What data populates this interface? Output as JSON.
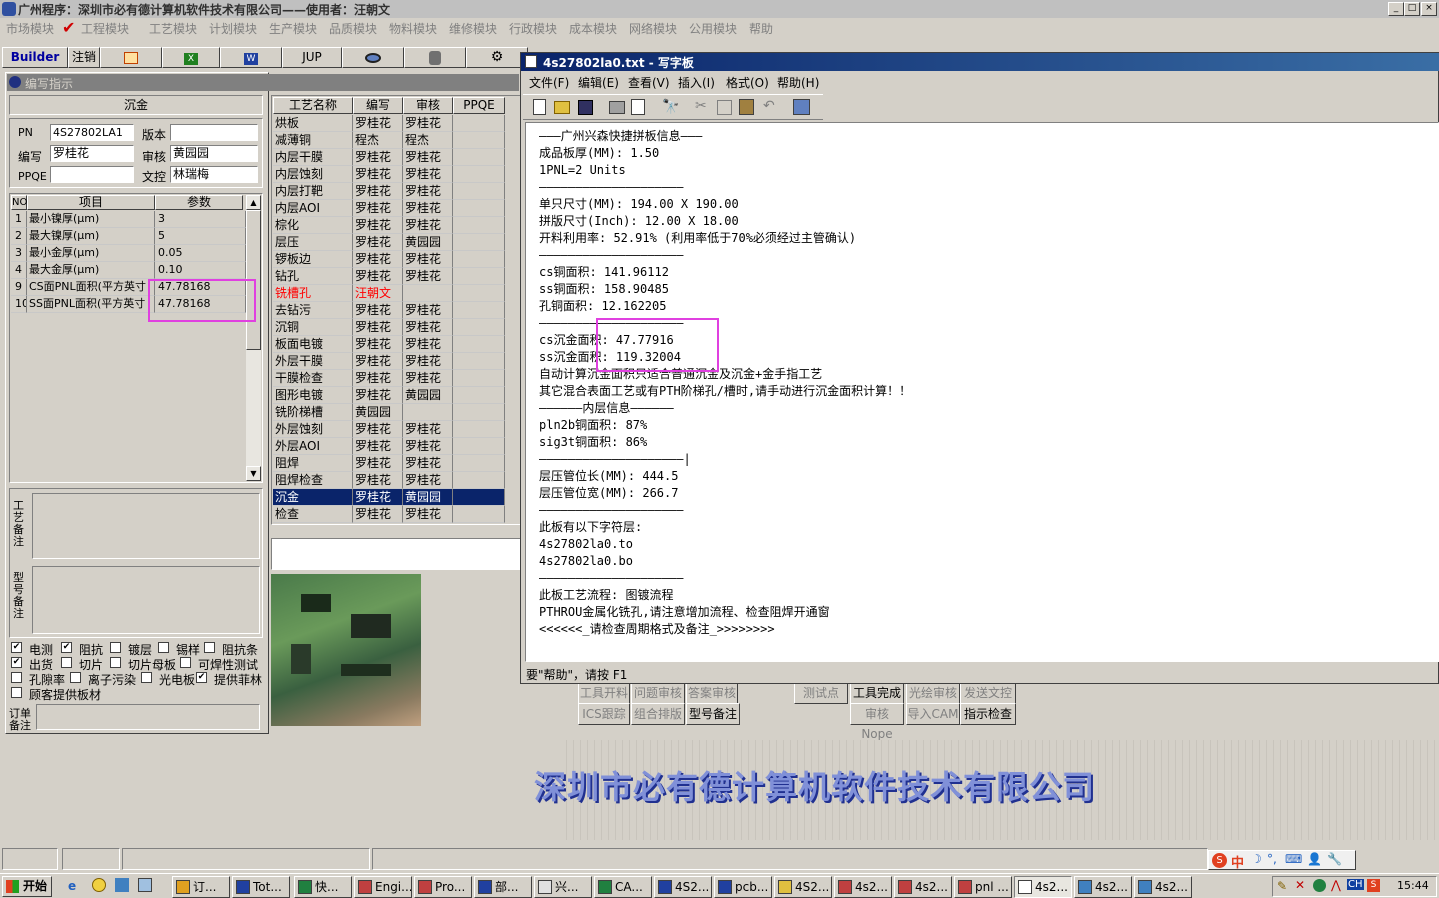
{
  "app": {
    "title": "广州程序：深圳市必有德计算机软件技术有限公司——使用者：汪朝文",
    "win_buttons": [
      "_",
      "□",
      "×"
    ],
    "menu": [
      "市场模块",
      "工程模块",
      "工艺模块",
      "计划模块",
      "生产模块",
      "品质模块",
      "物料模块",
      "维修模块",
      "行政模块",
      "成本模块",
      "网络模块",
      "公用模块",
      "帮助"
    ],
    "toolbar": [
      "Builder",
      "注销",
      "JUP"
    ],
    "brand": "深圳市必有德计算机软件技术有限公司"
  },
  "editor": {
    "title": "编写指示",
    "process": "沉金",
    "fields": {
      "pn_label": "PN",
      "pn": "4S27802LA1",
      "version_label": "版本",
      "version": "",
      "writer_label": "编写",
      "writer": "罗桂花",
      "reviewer_label": "审核",
      "reviewer": "黄园园",
      "ppqe_label": "PPQE",
      "ppqe": "",
      "doc_label": "文控",
      "doc": "林瑞梅"
    },
    "param_headers": [
      "NO",
      "项目",
      "参数"
    ],
    "params": [
      {
        "no": "1",
        "item": "最小镍厚(μm)",
        "value": "3"
      },
      {
        "no": "2",
        "item": "最大镍厚(μm)",
        "value": "5"
      },
      {
        "no": "3",
        "item": "最小金厚(μm)",
        "value": "0.05"
      },
      {
        "no": "4",
        "item": "最大金厚(μm)",
        "value": "0.10"
      },
      {
        "no": "9",
        "item": "CS面PNL面积(平方英寸",
        "value": "47.78168"
      },
      {
        "no": "10",
        "item": "SS面PNL面积(平方英寸",
        "value": "47.78168"
      }
    ],
    "remark1_label": "工艺备注",
    "remark2_label": "型号备注",
    "order_label": "订单备注",
    "checks": [
      {
        "label": "电测",
        "checked": true
      },
      {
        "label": "阻抗",
        "checked": true
      },
      {
        "label": "镀层",
        "checked": false
      },
      {
        "label": "锡样",
        "checked": false
      },
      {
        "label": "阻抗条",
        "checked": false
      },
      {
        "label": "出货",
        "checked": true
      },
      {
        "label": "切片",
        "checked": false
      },
      {
        "label": "切片母板",
        "checked": false
      },
      {
        "label": "可焊性测试",
        "checked": false
      },
      {
        "label": "孔隙率",
        "checked": false
      },
      {
        "label": "离子污染",
        "checked": false
      },
      {
        "label": "光电板",
        "checked": false
      },
      {
        "label": "提供菲林",
        "checked": true
      },
      {
        "label": "顾客提供板材",
        "checked": false
      }
    ]
  },
  "process_table": {
    "headers": [
      "工艺名称",
      "编写",
      "审核",
      "PPQE"
    ],
    "rows": [
      [
        "烘板",
        "罗桂花",
        "罗桂花"
      ],
      [
        "减薄铜",
        "程杰",
        "程杰"
      ],
      [
        "内层干膜",
        "罗桂花",
        "罗桂花"
      ],
      [
        "内层蚀刻",
        "罗桂花",
        "罗桂花"
      ],
      [
        "内层打靶",
        "罗桂花",
        "罗桂花"
      ],
      [
        "内层AOI",
        "罗桂花",
        "罗桂花"
      ],
      [
        "棕化",
        "罗桂花",
        "罗桂花"
      ],
      [
        "层压",
        "罗桂花",
        "黄园园"
      ],
      [
        "锣板边",
        "罗桂花",
        "罗桂花"
      ],
      [
        "钻孔",
        "罗桂花",
        "罗桂花"
      ],
      [
        "铣槽孔",
        "汪朝文",
        ""
      ],
      [
        "去钻污",
        "罗桂花",
        "罗桂花"
      ],
      [
        "沉铜",
        "罗桂花",
        "罗桂花"
      ],
      [
        "板面电镀",
        "罗桂花",
        "罗桂花"
      ],
      [
        "外层干膜",
        "罗桂花",
        "罗桂花"
      ],
      [
        "干膜检查",
        "罗桂花",
        "罗桂花"
      ],
      [
        "图形电镀",
        "罗桂花",
        "黄园园"
      ],
      [
        "铣阶梯槽",
        "黄园园",
        ""
      ],
      [
        "外层蚀刻",
        "罗桂花",
        "罗桂花"
      ],
      [
        "外层AOI",
        "罗桂花",
        "罗桂花"
      ],
      [
        "阻焊",
        "罗桂花",
        "罗桂花"
      ],
      [
        "阻焊检查",
        "罗桂花",
        "罗桂花"
      ],
      [
        "沉金",
        "罗桂花",
        "黄园园"
      ],
      [
        "检查",
        "罗桂花",
        "罗桂花"
      ]
    ],
    "highlight_row": 10,
    "selected_row": 22
  },
  "bottom_buttons": [
    "工具开料",
    "问题审核",
    "答案审核",
    "测试点",
    "工具完成",
    "光绘审核",
    "发送文控",
    "ICS跟踪",
    "组合排版",
    "型号备注",
    "审核Nope",
    "导入CAM",
    "指示检查"
  ],
  "wordpad": {
    "title": "4s27802la0.txt - 写字板",
    "menu": [
      "文件(F)",
      "编辑(E)",
      "查看(V)",
      "插入(I)",
      "格式(O)",
      "帮助(H)"
    ],
    "status": "要\"帮助\"，请按 F1",
    "lines": [
      "———广州兴森快捷拼板信息———",
      "成品板厚(MM): 1.50",
      "1PNL=2 Units",
      "————————————————————",
      "单只尺寸(MM): 194.00 X 190.00",
      "拼版尺寸(Inch): 12.00 X 18.00",
      "开料利用率: 52.91% (利用率低于70%必须经过主管确认)",
      "————————————————————",
      "cs铜面积: 141.96112",
      "ss铜面积: 158.90485",
      "孔铜面积: 12.162205",
      "————————————————————",
      "cs沉金面积: 47.77916",
      "ss沉金面积: 119.32004",
      "自动计算沉金面积只适合普通沉金及沉金+金手指工艺",
      "其它混合表面工艺或有PTH阶梯孔/槽时,请手动进行沉金面积计算！！",
      "——————内层信息——————",
      "pln2b铜面积: 87%",
      "sig3t铜面积: 86%",
      "————————————————————|",
      "层压管位长(MM): 444.5",
      "层压管位宽(MM): 266.7",
      "————————————————————",
      "此板有以下字符层:",
      "4s27802la0.to",
      "4s27802la0.bo",
      "————————————————————",
      "此板工艺流程: 图镀流程",
      "PTHROU金属化铣孔,请注意增加流程、检查阻焊开通窗",
      "<<<<<<_请检查周期格式及备注_>>>>>>>>"
    ]
  },
  "taskbar": {
    "start": "开始",
    "tasks": [
      "订...",
      "Tot...",
      "快...",
      "Engi...",
      "Pro...",
      "部...",
      "兴...",
      "CA...",
      "4S2...",
      "pcb...",
      "4S2...",
      "4s2...",
      "4s2...",
      "pnl ...",
      "4s2...",
      "4s2...",
      "4s2..."
    ],
    "ime": "中",
    "lang": "CH",
    "clock": "15:44"
  },
  "colors": {
    "titlebar": "#c0c0c0",
    "wp_title": "#0a246a",
    "selected_row": "#0a246a",
    "highlight_box": "#e040e0",
    "red_text": "#ff0000"
  }
}
